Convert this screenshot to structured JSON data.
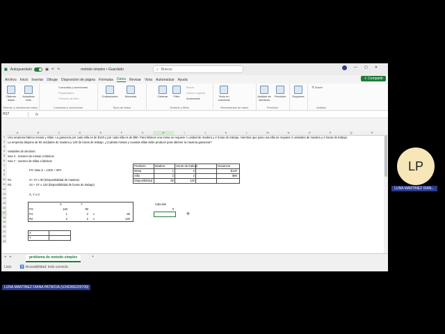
{
  "titlebar": {
    "autosave": "Autoguardado",
    "doc_title": "metodo simplex • Guardado",
    "search_placeholder": "Buscar"
  },
  "menu": [
    "Archivo",
    "Inicio",
    "Insertar",
    "Dibujar",
    "Disposición de página",
    "Fórmulas",
    "Datos",
    "Revisar",
    "Vista",
    "Automatizar",
    "Ayuda"
  ],
  "share_label": "Compartir",
  "ribbon": {
    "obtener": "Obtener datos",
    "actualizar": "Actualizar todo",
    "consultas": "Consultas y conexiones",
    "propiedades": "Propiedades",
    "vinculos": "Vínculos de libro",
    "cotizaciones": "Cotizaciones",
    "monedas": "Monedas",
    "ordenar": "Ordenar",
    "filtro": "Filtro",
    "borrar": "Borrar",
    "reaplicar": "Volver a aplicar",
    "avanzadas": "Avanzadas",
    "texto_columnas": "Texto en columnas",
    "analisis": "Análisis de hipótesis",
    "prevision": "Previsión",
    "esquema": "Esquema",
    "solver": "Solver",
    "g_obtener": "Obtener y transformar datos",
    "g_consultas": "Consultas y conexiones",
    "g_tipos": "Tipos de datos",
    "g_ordenar": "Ordenar y filtrar",
    "g_herr": "Herramientas de datos",
    "g_prev": "Previsión",
    "g_analisis": "Análisis"
  },
  "formula": {
    "namebox": "H17",
    "fx": "fx"
  },
  "columns": [
    "A",
    "B",
    "C",
    "D",
    "E",
    "F",
    "G",
    "H",
    "I",
    "J",
    "K",
    "L",
    "M",
    "N",
    "O",
    "P",
    "Q",
    "R"
  ],
  "rows": [
    "1",
    "2",
    "3",
    "4",
    "5",
    "6",
    "7",
    "8",
    "9",
    "10",
    "11",
    "12",
    "13",
    "14",
    "15",
    "16",
    "17",
    "18",
    "19",
    "20",
    "21",
    "22",
    "23"
  ],
  "cells": {
    "r1": "Una empresa fabrica mesas y sillas. La ganancia por cada silla es de $120 y por cada silla es de $90. Para fabricar una mesa se requiere 1 unidad de madera y 2 horas de trabajo, mientras que para una silla se requiere 2 unidades de madera y 2 horas de trabajo.",
    "r2": "La empresa dispone de 80 unidades de madera y 120 de horas de trabajo. ¿Cuántas mesas y cuantas sillas debe producir para obtener la maxima ganancia?",
    "r4": "Variables de decision:",
    "r5": "Sea X : numero de mesas a fabricar",
    "r6": "Sea Y : numero de sillas a fabricar",
    "fo": "FO: Max Z = 120X + 90Y",
    "r1a": "R1",
    "r1b": "X+ 2Y ≤ 80 (Disponibilidad de madera)",
    "r2a": "R2",
    "r2b": "2X + 2Y ≤ 120    (Disponibilidad de horas de trabajo)",
    "nonneg": "X, Y ≥ 0",
    "t_prod": "Producto",
    "t_mad": "Madera",
    "t_horas": "Horas de trabajo",
    "t_gan": "Ganancia",
    "t_mesa": "Mesa",
    "t_mesa_m": "1",
    "t_mesa_h": "2",
    "t_mesa_g": "$120",
    "t_silla": "Silla",
    "t_silla_m": "2",
    "t_silla_h": "2",
    "t_silla_g": "$90",
    "t_disp": "Disponibilidad",
    "t_disp_m": "80",
    "t_disp_h": "120",
    "calculos": "Calculos",
    "calc_val": "0",
    "m_x": "X",
    "m_y": "Y",
    "m_fo": "FO",
    "m_fo_x": "120",
    "m_fo_y": "90",
    "m_r1": "R1",
    "m_r1_x": "1",
    "m_r1_y": "2",
    "m_r1_le": "≤",
    "m_r1_v": "80",
    "m_r2": "R2",
    "m_r2_x": "2",
    "m_r2_y": "2",
    "m_r2_le": "≤",
    "m_r2_v": "120",
    "b_x": "X",
    "b_y": "Y"
  },
  "sheet_tab": "problema de metodo simplex",
  "status": {
    "ready": "Listo",
    "access": "Accesibilidad: todo correcto"
  },
  "presenter": {
    "initials": "LP",
    "name_short": "LUNA MARTINEZ DIAN...",
    "name_full": "LUNA MARTINEZ DIANA PATRICIA (U240306220709)"
  }
}
